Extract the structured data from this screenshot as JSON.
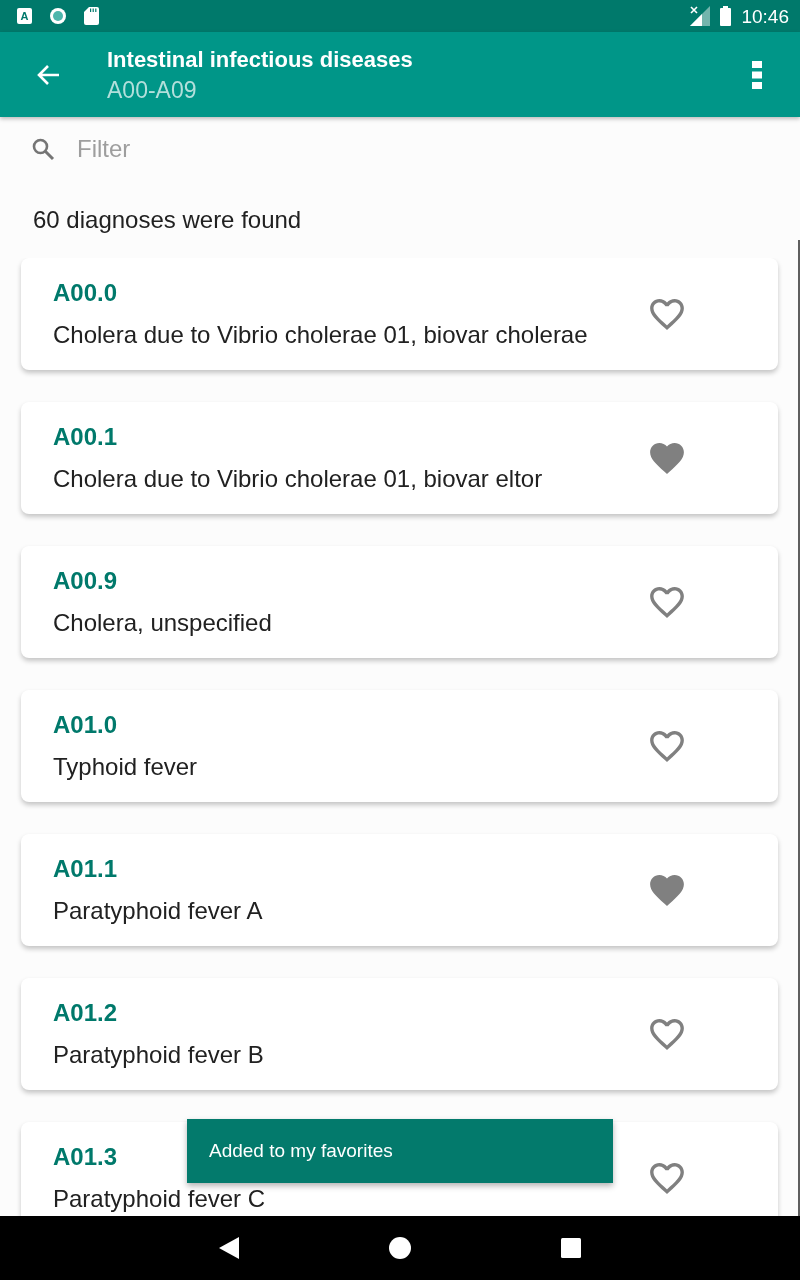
{
  "status_bar": {
    "notification_letter": "A",
    "time": "10:46"
  },
  "app_bar": {
    "title": "Intestinal infectious diseases",
    "subtitle": "A00-A09"
  },
  "filter": {
    "placeholder": "Filter"
  },
  "result_count": "60 diagnoses were found",
  "diagnoses": [
    {
      "code": "A00.0",
      "name": "Cholera due to Vibrio cholerae 01, biovar cholerae",
      "favorite": false
    },
    {
      "code": "A00.1",
      "name": "Cholera due to Vibrio cholerae 01, biovar eltor",
      "favorite": true
    },
    {
      "code": "A00.9",
      "name": "Cholera, unspecified",
      "favorite": false
    },
    {
      "code": "A01.0",
      "name": "Typhoid fever",
      "favorite": false
    },
    {
      "code": "A01.1",
      "name": "Paratyphoid fever A",
      "favorite": true
    },
    {
      "code": "A01.2",
      "name": "Paratyphoid fever B",
      "favorite": false
    },
    {
      "code": "A01.3",
      "name": "Paratyphoid fever C",
      "favorite": false
    }
  ],
  "snackbar": {
    "message": "Added to my favorites"
  }
}
